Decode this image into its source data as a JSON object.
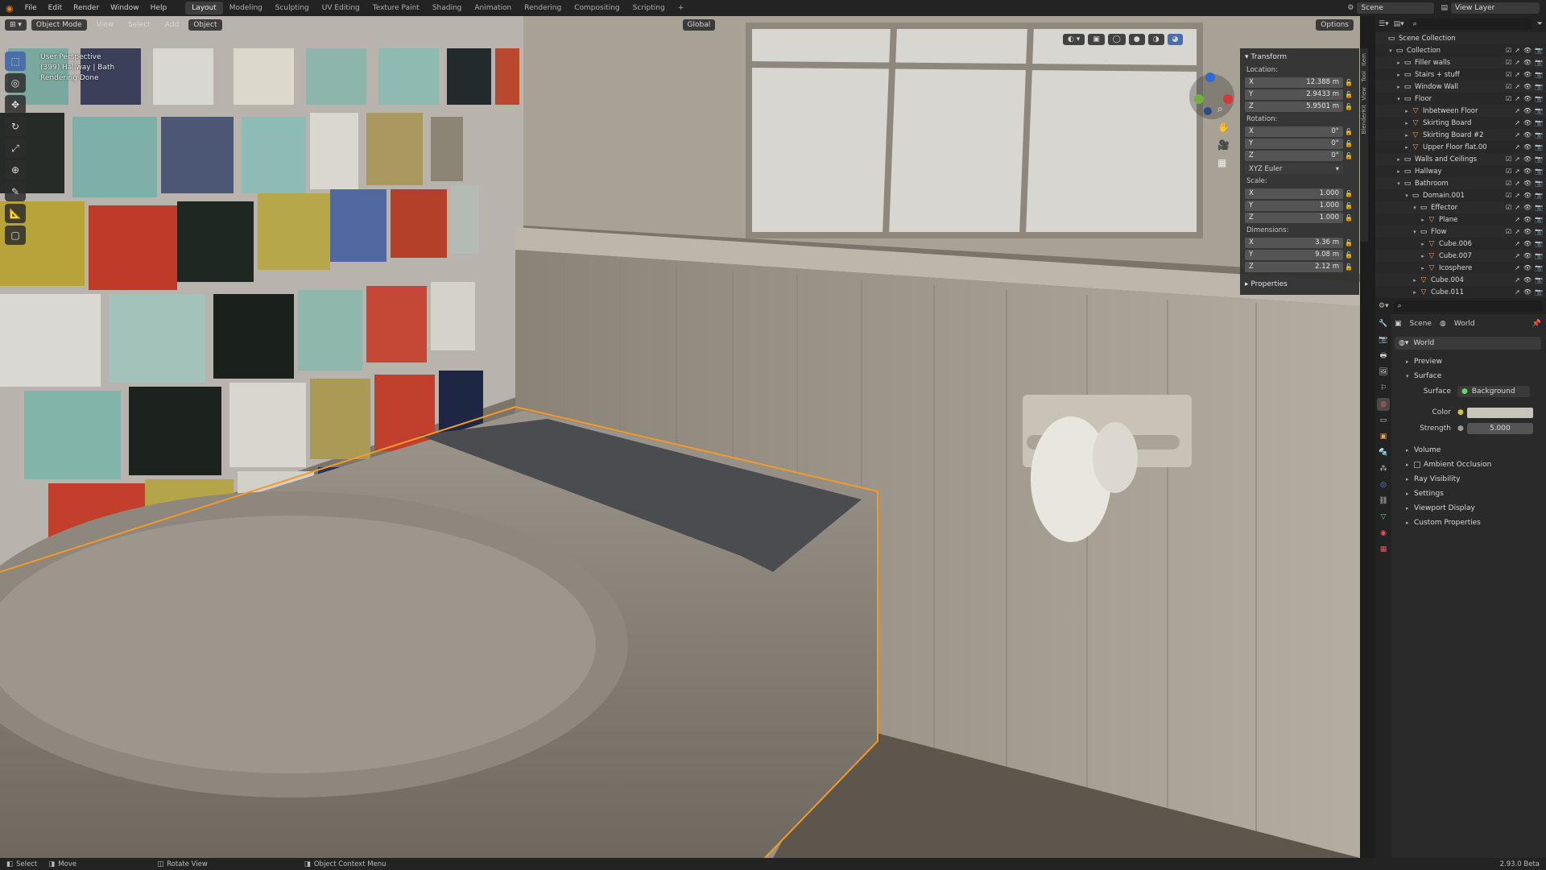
{
  "topbar": {
    "menus": [
      "File",
      "Edit",
      "Render",
      "Window",
      "Help"
    ],
    "workspaces": [
      "Layout",
      "Modeling",
      "Sculpting",
      "UV Editing",
      "Texture Paint",
      "Shading",
      "Animation",
      "Rendering",
      "Compositing",
      "Scripting"
    ],
    "active_workspace": "Layout",
    "add_tab": "+",
    "scene": "Scene",
    "view_layer": "View Layer"
  },
  "viewport": {
    "mode": "Object Mode",
    "menus": [
      "View",
      "Select",
      "Add",
      "Object"
    ],
    "transform_orientation": "Global",
    "options": "Options",
    "overlay_lines": [
      "User Perspective",
      "(399) Hallway | Bath",
      "Rendering Done"
    ]
  },
  "npanel": {
    "tabs": [
      "Item",
      "Tool",
      "View",
      "BlenderKit"
    ],
    "transform_title": "Transform",
    "location_label": "Location:",
    "location": [
      {
        "axis": "X",
        "value": "12.388 m"
      },
      {
        "axis": "Y",
        "value": "2.9433 m"
      },
      {
        "axis": "Z",
        "value": "5.9501 m"
      }
    ],
    "rotation_label": "Rotation:",
    "rotation": [
      {
        "axis": "X",
        "value": "0°"
      },
      {
        "axis": "Y",
        "value": "0°"
      },
      {
        "axis": "Z",
        "value": "0°"
      }
    ],
    "rotation_mode": "XYZ Euler",
    "scale_label": "Scale:",
    "scale": [
      {
        "axis": "X",
        "value": "1.000"
      },
      {
        "axis": "Y",
        "value": "1.000"
      },
      {
        "axis": "Z",
        "value": "1.000"
      }
    ],
    "dimensions_label": "Dimensions:",
    "dimensions": [
      {
        "axis": "X",
        "value": "3.36 m"
      },
      {
        "axis": "Y",
        "value": "9.08 m"
      },
      {
        "axis": "Z",
        "value": "2.12 m"
      }
    ],
    "properties_title": "Properties"
  },
  "outliner": {
    "rows": [
      {
        "name": "Scene Collection",
        "depth": 0,
        "icon": "coll",
        "arrow": ""
      },
      {
        "name": "Collection",
        "depth": 1,
        "icon": "coll",
        "arrow": "▾"
      },
      {
        "name": "Filler walls",
        "depth": 2,
        "icon": "coll",
        "arrow": "▸"
      },
      {
        "name": "Stairs + stuff",
        "depth": 2,
        "icon": "coll",
        "arrow": "▸"
      },
      {
        "name": "Window Wall",
        "depth": 2,
        "icon": "coll",
        "arrow": "▸"
      },
      {
        "name": "Floor",
        "depth": 2,
        "icon": "coll",
        "arrow": "▾"
      },
      {
        "name": "Inbetween Floor",
        "depth": 3,
        "icon": "mesh",
        "arrow": "▸"
      },
      {
        "name": "Skirting Board",
        "depth": 3,
        "icon": "mesh",
        "arrow": "▸"
      },
      {
        "name": "Skirting Board #2",
        "depth": 3,
        "icon": "mesh",
        "arrow": "▸"
      },
      {
        "name": "Upper Floor flat.00",
        "depth": 3,
        "icon": "mesh",
        "arrow": "▸"
      },
      {
        "name": "Walls and Ceilings",
        "depth": 2,
        "icon": "coll",
        "arrow": "▸"
      },
      {
        "name": "Hallway",
        "depth": 2,
        "icon": "coll",
        "arrow": "▸"
      },
      {
        "name": "Bathroom",
        "depth": 2,
        "icon": "coll",
        "arrow": "▾"
      },
      {
        "name": "Domain.001",
        "depth": 3,
        "icon": "coll",
        "arrow": "▾"
      },
      {
        "name": "Effector",
        "depth": 4,
        "icon": "coll",
        "arrow": "▾"
      },
      {
        "name": "Plane",
        "depth": 5,
        "icon": "mesh",
        "arrow": "▸"
      },
      {
        "name": "Flow",
        "depth": 4,
        "icon": "coll",
        "arrow": "▾"
      },
      {
        "name": "Cube.006",
        "depth": 5,
        "icon": "mesh",
        "arrow": "▸"
      },
      {
        "name": "Cube.007",
        "depth": 5,
        "icon": "mesh",
        "arrow": "▸"
      },
      {
        "name": "Icosphere",
        "depth": 5,
        "icon": "mesh",
        "arrow": "▸"
      },
      {
        "name": "Cube.004",
        "depth": 4,
        "icon": "mesh",
        "arrow": "▸"
      },
      {
        "name": "Cube.011",
        "depth": 4,
        "icon": "mesh",
        "arrow": "▸"
      }
    ]
  },
  "properties": {
    "breadcrumb": [
      "Scene",
      "World"
    ],
    "world_name": "World",
    "sections": {
      "preview": "Preview",
      "surface": "Surface",
      "volume": "Volume",
      "ambient_occlusion": "Ambient Occlusion",
      "ray_visibility": "Ray Visibility",
      "settings": "Settings",
      "viewport_display": "Viewport Display",
      "custom_properties": "Custom Properties"
    },
    "surface_label": "Surface",
    "surface_value": "Background",
    "color_label": "Color",
    "strength_label": "Strength",
    "strength_value": "5.000"
  },
  "status": {
    "select": "Select",
    "move": "Move",
    "rotate_view": "Rotate View",
    "context_menu": "Object Context Menu",
    "version": "2.93.0 Beta"
  },
  "colors": {
    "accent": "#4a6ea8",
    "selection_outline": "#f39a2b",
    "mesh_icon": "#f0a058"
  }
}
